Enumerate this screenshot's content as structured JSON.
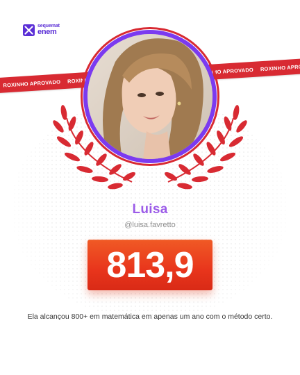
{
  "brand": {
    "small": "sequemat",
    "big": "enem",
    "color": "#5b2fd6"
  },
  "ribbon": {
    "text": "ROXINHO APROVADO",
    "color": "#d82a32"
  },
  "student": {
    "name": "Luisa",
    "handle": "@luisa.favretto"
  },
  "score": "813,9",
  "caption": "Ela alcançou 800+ em matemática em apenas um ano com o método certo.",
  "colors": {
    "accent_purple": "#9b5be8",
    "ring_purple": "#7b3af0",
    "ring_red": "#d82a32",
    "score_orange": "#e8351c"
  }
}
